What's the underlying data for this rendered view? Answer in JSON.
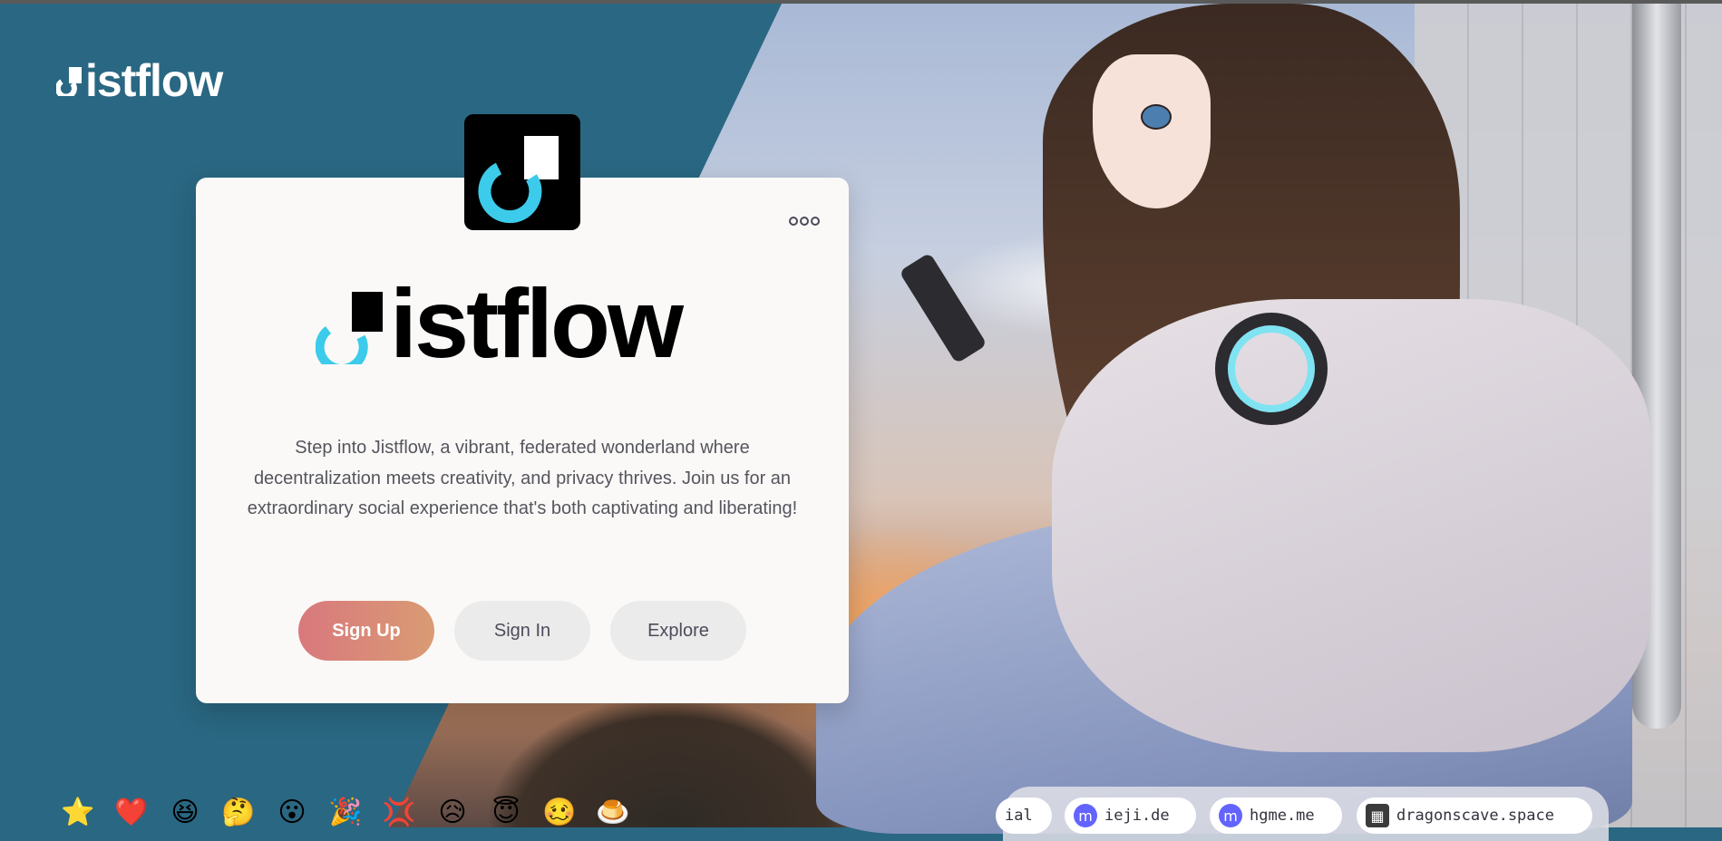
{
  "brand": {
    "name": "istflow"
  },
  "card": {
    "more_icon": "more-horizontal-icon",
    "hero_name": "istflow",
    "description": "Step into Jistflow, a vibrant, federated wonderland where decentralization meets creativity, and privacy thrives. Join us for an extraordinary social experience that's both captivating and liberating!",
    "buttons": {
      "signup": "Sign Up",
      "signin": "Sign In",
      "explore": "Explore"
    }
  },
  "emojis": [
    "⭐",
    "❤️",
    "😆",
    "🤔",
    "😮",
    "🎉",
    "💢",
    "😥",
    "😇",
    "🥴",
    "🍮"
  ],
  "instances": [
    {
      "label": "ial",
      "icon": ""
    },
    {
      "label": "ieji.de",
      "icon": "mastodon-icon"
    },
    {
      "label": "hgme.me",
      "icon": "mastodon-icon"
    },
    {
      "label": "dragonscave.space",
      "icon": "server-icon"
    }
  ],
  "colors": {
    "background": "#2a6782",
    "accent_cyan": "#3ccbea",
    "signup_start": "#d9787d",
    "signup_end": "#d99b74"
  }
}
